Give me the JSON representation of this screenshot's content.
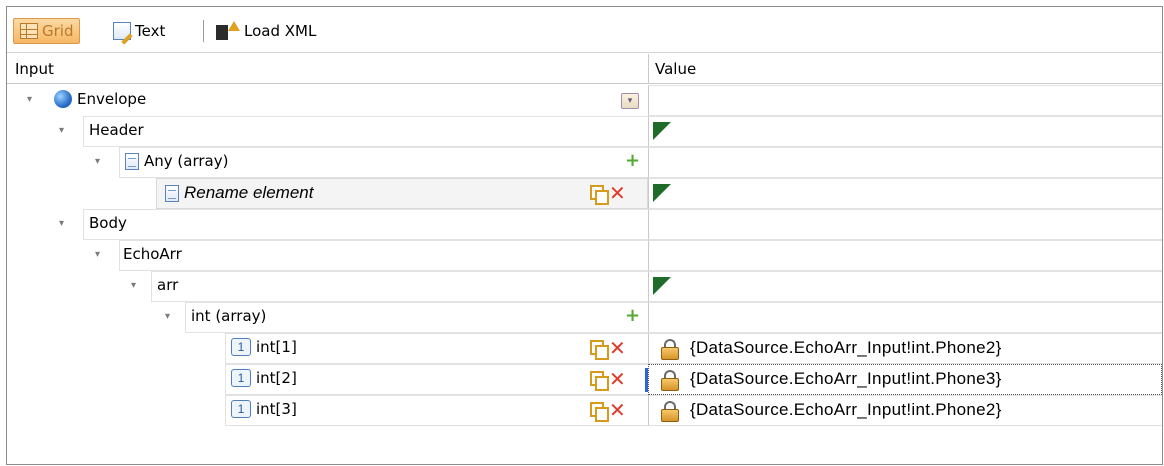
{
  "toolbar": {
    "grid_label": "Grid",
    "text_label": "Text",
    "load_label": "Load XML"
  },
  "columns": {
    "input": "Input",
    "value": "Value"
  },
  "tree": {
    "envelope": "Envelope",
    "header": "Header",
    "any": "Any  (array)",
    "rename": "Rename element",
    "body": "Body",
    "echoarr": "EchoArr",
    "arr": "arr",
    "int_array": "int  (array)",
    "int1": "int[1]",
    "int2": "int[2]",
    "int3": "int[3]"
  },
  "values": {
    "int1": "{DataSource.EchoArr_Input!int.Phone2}",
    "int2": "{DataSource.EchoArr_Input!int.Phone3}",
    "int3": "{DataSource.EchoArr_Input!int.Phone2}"
  },
  "icons": {
    "index_glyph": "1",
    "plus_glyph": "+",
    "delete_glyph": "✕",
    "expand_glyph": "▾"
  },
  "colors": {
    "accent_toolbar": "#f6b865",
    "flag_green": "#1e6b2a",
    "delete_red": "#e2392b",
    "add_green": "#55a832"
  }
}
